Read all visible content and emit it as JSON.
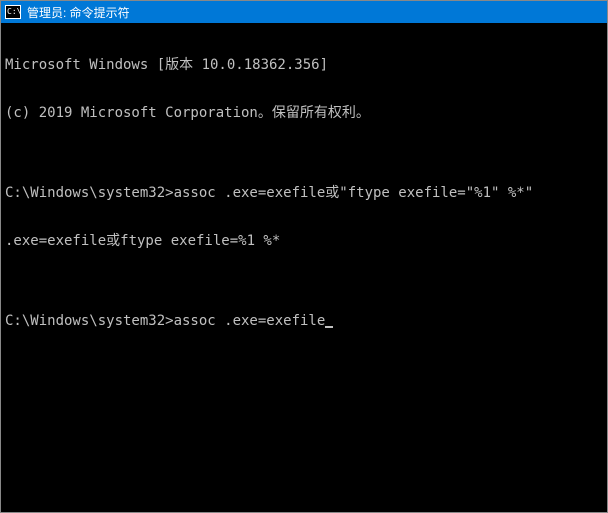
{
  "titlebar": {
    "icon_text": "C:\\",
    "title": "管理员: 命令提示符"
  },
  "terminal": {
    "lines": [
      "Microsoft Windows [版本 10.0.18362.356]",
      "(c) 2019 Microsoft Corporation。保留所有权利。",
      "",
      "C:\\Windows\\system32>assoc .exe=exefile或\"ftype exefile=\"%1\" %*\"",
      ".exe=exefile或ftype exefile=%1 %*",
      "",
      "C:\\Windows\\system32>assoc .exe=exefile"
    ]
  }
}
